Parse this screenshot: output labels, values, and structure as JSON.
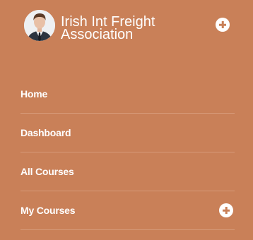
{
  "header": {
    "org_name": "Irish Int Freight Association",
    "avatar_icon": "user-avatar",
    "expand_icon": "plus-circle-icon"
  },
  "menu": {
    "items": [
      {
        "label": "Home",
        "has_expand": false
      },
      {
        "label": "Dashboard",
        "has_expand": false
      },
      {
        "label": "All Courses",
        "has_expand": false
      },
      {
        "label": "My Courses",
        "has_expand": true,
        "expand_icon": "plus-circle-icon"
      }
    ]
  },
  "colors": {
    "background": "#c98058",
    "divider": "#d69a79",
    "text": "#ffffff"
  }
}
